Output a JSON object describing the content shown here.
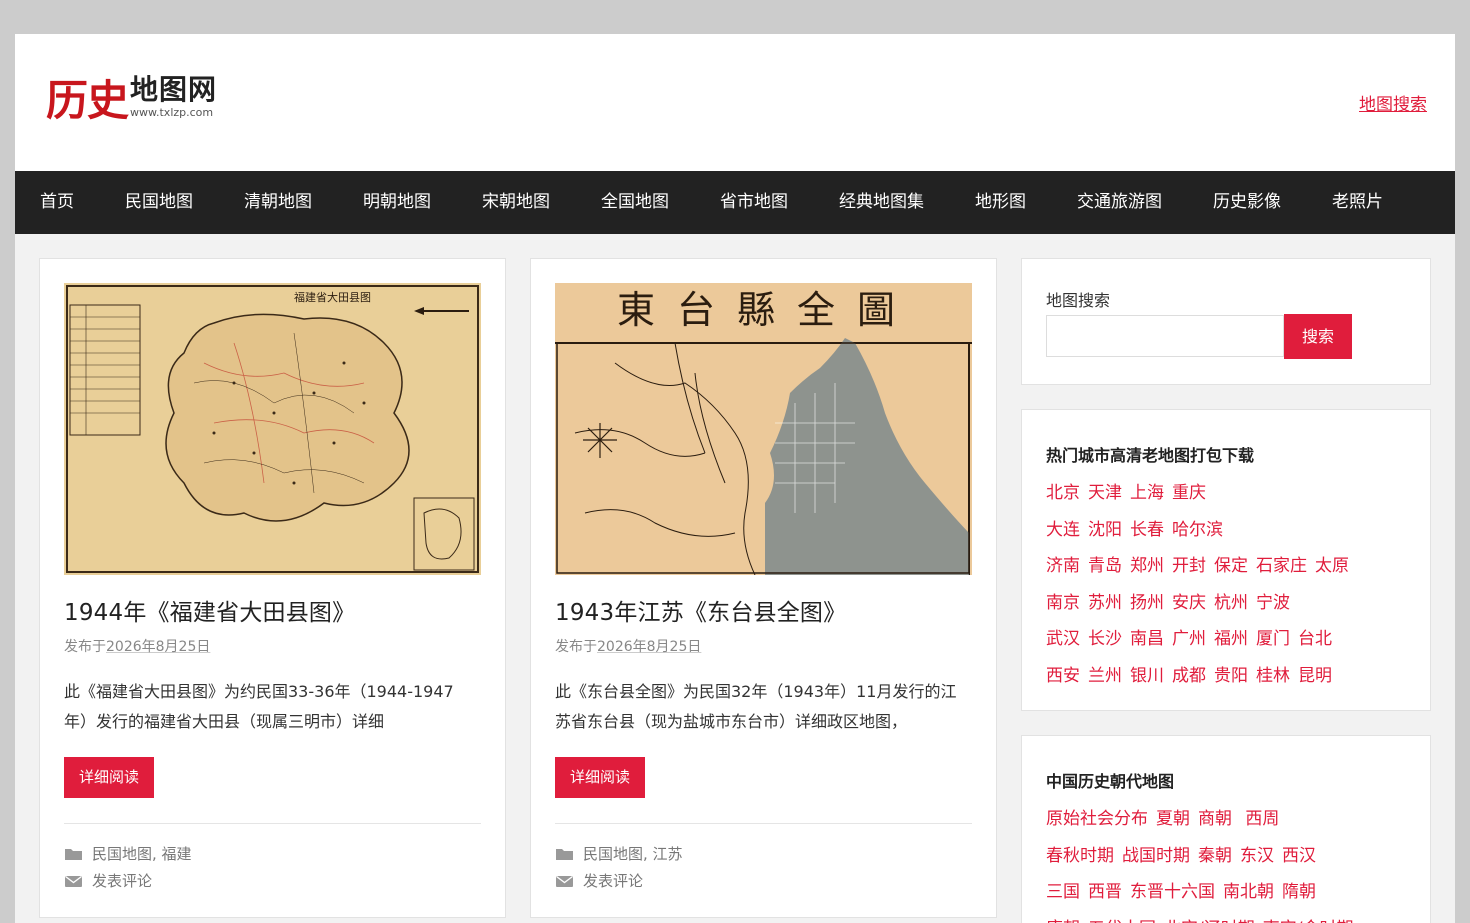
{
  "site": {
    "logo_red": "历史",
    "logo_black": "地图网",
    "logo_url": "www.txlzp.com",
    "header_link": "地图搜索"
  },
  "nav": [
    "首页",
    "民国地图",
    "清朝地图",
    "明朝地图",
    "宋朝地图",
    "全国地图",
    "省市地图",
    "经典地图集",
    "地形图",
    "交通旅游图",
    "历史影像",
    "老照片"
  ],
  "posts": [
    {
      "title": "1944年《福建省大田县图》",
      "meta_prefix": "发布于",
      "date": "2026年8月25日",
      "excerpt": "此《福建省大田县图》为约民国33-36年（1944-1947年）发行的福建省大田县（现属三明市）详细",
      "read_more": "详细阅读",
      "categories": "民国地图, 福建",
      "comment": "发表评论",
      "thumb_heading": "福建省大田县图"
    },
    {
      "title": "1943年江苏《东台县全图》",
      "meta_prefix": "发布于",
      "date": "2026年8月25日",
      "excerpt": "此《东台县全图》为民国32年（1943年）11月发行的江苏省东台县（现为盐城市东台市）详细政区地图，",
      "read_more": "详细阅读",
      "categories": "民国地图, 江苏",
      "comment": "发表评论",
      "thumb_heading": "東台縣全圖"
    }
  ],
  "sidebar": {
    "search": {
      "label": "地图搜索",
      "placeholder": "",
      "button": "搜索"
    },
    "hot_cities": {
      "title": "热门城市高清老地图打包下载",
      "rows": [
        [
          "北京",
          "天津",
          "上海",
          "重庆"
        ],
        [
          "大连",
          "沈阳",
          "长春",
          "哈尔滨"
        ],
        [
          "济南",
          "青岛",
          "郑州",
          "开封",
          "保定",
          "石家庄",
          "太原"
        ],
        [
          "南京",
          "苏州",
          "扬州",
          "安庆",
          "杭州",
          "宁波"
        ],
        [
          "武汉",
          "长沙",
          "南昌",
          "广州",
          "福州",
          "厦门",
          "台北"
        ],
        [
          "西安",
          "兰州",
          "银川",
          "成都",
          "贵阳",
          "桂林",
          "昆明"
        ]
      ]
    },
    "dynasties": {
      "title": "中国历史朝代地图",
      "rows": [
        [
          "原始社会分布",
          "夏朝",
          "商朝",
          " 西周"
        ],
        [
          "春秋时期",
          "战国时期",
          "秦朝",
          "东汉",
          "西汉"
        ],
        [
          "三国",
          "西晋",
          "东晋十六国",
          "南北朝",
          "隋朝"
        ],
        [
          "唐朝",
          "五代十国",
          "北宋/辽时期",
          "南宋/金时期"
        ]
      ]
    }
  },
  "colors": {
    "accent": "#e01d3c",
    "nav_bg": "#222222",
    "logo_red": "#c8161d"
  }
}
